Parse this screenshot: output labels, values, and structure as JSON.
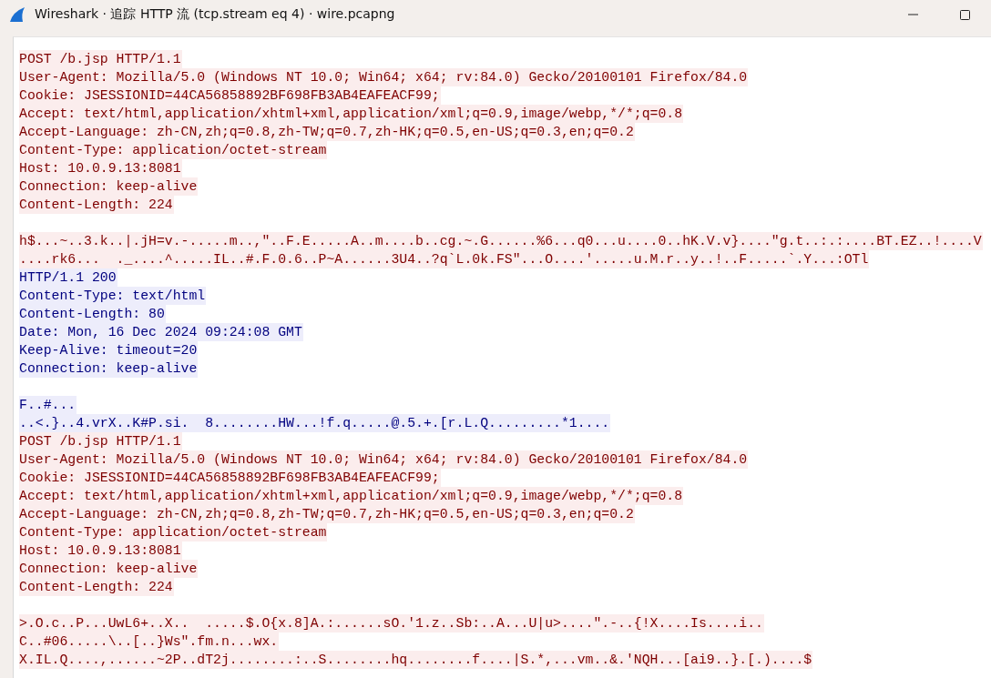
{
  "window": {
    "title": "Wireshark · 追踪 HTTP 流 (tcp.stream eq 4) · wire.pcapng"
  },
  "stream": [
    {
      "kind": "client",
      "text": "POST /b.jsp HTTP/1.1"
    },
    {
      "kind": "client",
      "text": "User-Agent: Mozilla/5.0 (Windows NT 10.0; Win64; x64; rv:84.0) Gecko/20100101 Firefox/84.0"
    },
    {
      "kind": "client",
      "text": "Cookie: JSESSIONID=44CA56858892BF698FB3AB4EAFEACF99;"
    },
    {
      "kind": "client",
      "text": "Accept: text/html,application/xhtml+xml,application/xml;q=0.9,image/webp,*/*;q=0.8"
    },
    {
      "kind": "client",
      "text": "Accept-Language: zh-CN,zh;q=0.8,zh-TW;q=0.7,zh-HK;q=0.5,en-US;q=0.3,en;q=0.2"
    },
    {
      "kind": "client",
      "text": "Content-Type: application/octet-stream"
    },
    {
      "kind": "client",
      "text": "Host: 10.0.9.13:8081"
    },
    {
      "kind": "client",
      "text": "Connection: keep-alive"
    },
    {
      "kind": "client",
      "text": "Content-Length: 224"
    },
    {
      "kind": "blank"
    },
    {
      "kind": "client",
      "text": "h$...~..3.k..|.jH=v.-.....m..,\"..F.E.....A..m....b..cg.~.G......%6...q0...u....0..hK.V.v}....\"g.t..:.:....BT.EZ..!....V"
    },
    {
      "kind": "client",
      "text": "....rk6...  ._....^.....IL..#.F.0.6..P~A......3U4..?q`L.0k.FS\"...O....'.....u.M.r..y..!..F.....`.Y...:OTl"
    },
    {
      "kind": "server",
      "text": "HTTP/1.1 200"
    },
    {
      "kind": "server",
      "text": "Content-Type: text/html"
    },
    {
      "kind": "server",
      "text": "Content-Length: 80"
    },
    {
      "kind": "server",
      "text": "Date: Mon, 16 Dec 2024 09:24:08 GMT"
    },
    {
      "kind": "server",
      "text": "Keep-Alive: timeout=20"
    },
    {
      "kind": "server",
      "text": "Connection: keep-alive"
    },
    {
      "kind": "blank"
    },
    {
      "kind": "server",
      "text": "F..#..."
    },
    {
      "kind": "server",
      "text": "..<.}..4.vrX..K#P.si.  8........HW...!f.q.....@.5.+.[r.L.Q.........*1...."
    },
    {
      "kind": "client",
      "text": "POST /b.jsp HTTP/1.1"
    },
    {
      "kind": "client",
      "text": "User-Agent: Mozilla/5.0 (Windows NT 10.0; Win64; x64; rv:84.0) Gecko/20100101 Firefox/84.0"
    },
    {
      "kind": "client",
      "text": "Cookie: JSESSIONID=44CA56858892BF698FB3AB4EAFEACF99;"
    },
    {
      "kind": "client",
      "text": "Accept: text/html,application/xhtml+xml,application/xml;q=0.9,image/webp,*/*;q=0.8"
    },
    {
      "kind": "client",
      "text": "Accept-Language: zh-CN,zh;q=0.8,zh-TW;q=0.7,zh-HK;q=0.5,en-US;q=0.3,en;q=0.2"
    },
    {
      "kind": "client",
      "text": "Content-Type: application/octet-stream"
    },
    {
      "kind": "client",
      "text": "Host: 10.0.9.13:8081"
    },
    {
      "kind": "client",
      "text": "Connection: keep-alive"
    },
    {
      "kind": "client",
      "text": "Content-Length: 224"
    },
    {
      "kind": "blank"
    },
    {
      "kind": "client",
      "text": ">.O.c..P...UwL6+..X..  .....$.O{x.8]A.:......sO.'1.z..Sb:..A...U|u>....\".-..{!X....Is....i.."
    },
    {
      "kind": "client",
      "text": "C..#06.....\\..[..}Ws\".fm.n...wx."
    },
    {
      "kind": "client",
      "text": "X.IL.Q....,......~2P..dT2j........:..S........hq........f....|S.*,...vm..&.'NQH...[ai9..}.[.)....$"
    }
  ]
}
